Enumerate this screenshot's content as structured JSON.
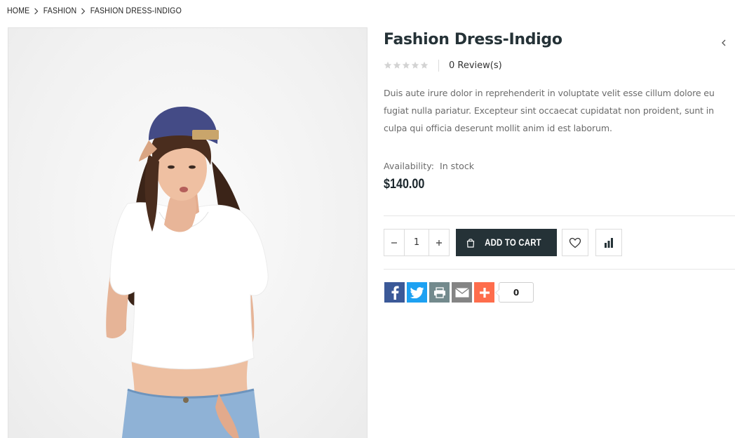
{
  "breadcrumb": {
    "items": [
      "HOME",
      "FASHION",
      "FASHION DRESS-INDIGO"
    ]
  },
  "product": {
    "title": "Fashion Dress-Indigo",
    "rating": {
      "stars_filled": 0,
      "stars_total": 5,
      "reviews_label": "0 Review(s)"
    },
    "description": "Duis aute irure dolor in reprehenderit in voluptate velit esse cillum dolore eu fugiat nulla pariatur. Excepteur sint occaecat cupidatat non proident, sunt in culpa qui officia deserunt mollit anim id est laborum.",
    "availability_label": "Availability:",
    "availability_value": "In stock",
    "price": "$140.00"
  },
  "cart": {
    "quantity": "1",
    "add_to_cart_label": "ADD TO CART"
  },
  "share": {
    "buttons": [
      "facebook",
      "twitter",
      "print",
      "email",
      "addthis"
    ],
    "count": "0"
  },
  "colors": {
    "primary": "#253237",
    "text_muted": "#6b6b6b",
    "facebook": "#3b5998",
    "twitter": "#1da1f2",
    "print": "#738a8d",
    "email": "#848484",
    "addthis": "#fe6d4c",
    "star_empty": "#d3d3d3"
  }
}
